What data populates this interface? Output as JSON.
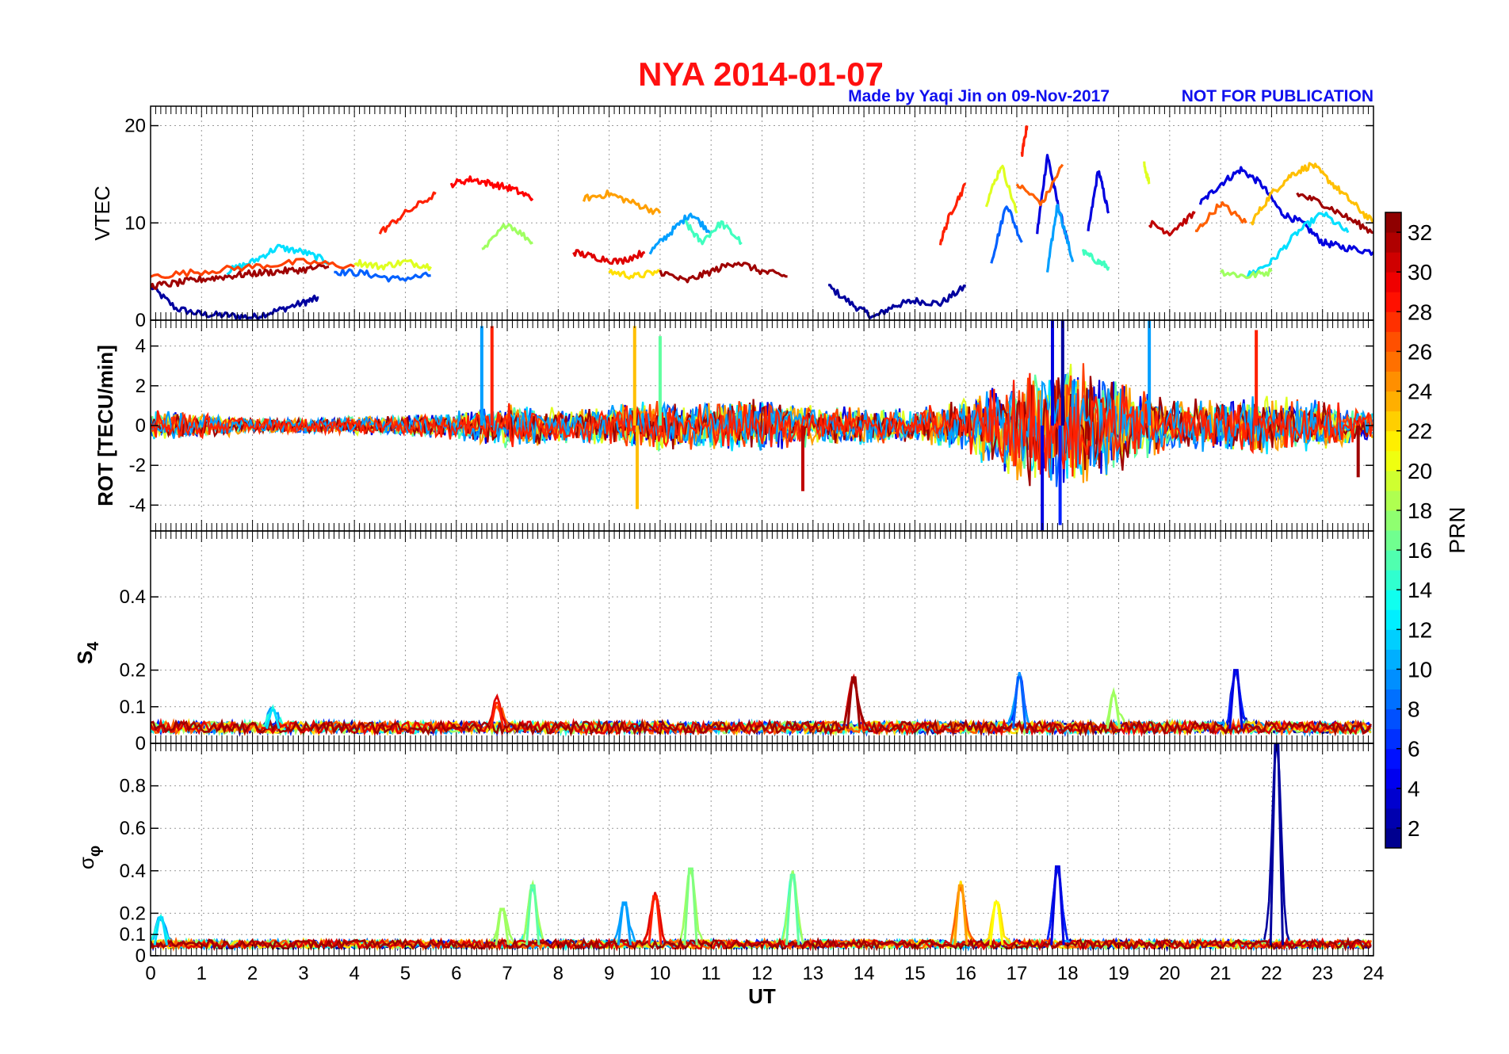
{
  "figure": {
    "title": "NYA   2014-01-07",
    "credit": "Made by Yaqi Jin on 09-Nov-2017",
    "notice": "NOT FOR PUBLICATION",
    "title_color": "#ff1010",
    "credit_color": "#1010ee"
  },
  "chart_data": [
    {
      "type": "line",
      "panel": "vtec",
      "ylabel": "VTEC",
      "xlabel": "",
      "xlim": [
        0,
        24
      ],
      "ylim": [
        0,
        22
      ],
      "yticks": [
        0,
        10,
        20
      ],
      "grid": true,
      "series_color_by": "PRN",
      "series": [
        {
          "prn": 2,
          "x": [
            0,
            0.5,
            1,
            1.5,
            2,
            2.5,
            3,
            3.3
          ],
          "y": [
            3.5,
            1.2,
            0.6,
            0.5,
            0.3,
            1.0,
            1.8,
            2.3
          ]
        },
        {
          "prn": 2,
          "x": [
            13.3,
            13.8,
            14.2,
            14.6,
            15,
            15.5,
            16
          ],
          "y": [
            3.5,
            1.5,
            0.3,
            1.5,
            2.0,
            1.7,
            3.5
          ]
        },
        {
          "prn": 4,
          "x": [
            17.4,
            17.6,
            17.8,
            18
          ],
          "y": [
            9,
            17,
            12,
            8
          ]
        },
        {
          "prn": 4,
          "x": [
            18.4,
            18.6,
            18.8
          ],
          "y": [
            9,
            15.5,
            11
          ]
        },
        {
          "prn": 4,
          "x": [
            20.6,
            21,
            21.4,
            21.8,
            22.2,
            22.6,
            23,
            23.4,
            24
          ],
          "y": [
            12,
            14,
            15.5,
            14,
            11,
            10,
            8,
            7.5,
            7
          ]
        },
        {
          "prn": 8,
          "x": [
            16.5,
            16.8,
            17.1
          ],
          "y": [
            6,
            12,
            8
          ]
        },
        {
          "prn": 8,
          "x": [
            3.6,
            4.2,
            4.8,
            5.5
          ],
          "y": [
            5.0,
            4.8,
            4.2,
            4.6
          ]
        },
        {
          "prn": 10,
          "x": [
            17.6,
            17.8,
            18.1
          ],
          "y": [
            5,
            12,
            6
          ]
        },
        {
          "prn": 10,
          "x": [
            9.8,
            10.2,
            10.6,
            11
          ],
          "y": [
            7,
            9,
            11,
            9
          ]
        },
        {
          "prn": 12,
          "x": [
            1.5,
            2,
            2.5,
            3,
            3.5
          ],
          "y": [
            5,
            6,
            7.5,
            7,
            6
          ]
        },
        {
          "prn": 12,
          "x": [
            21.5,
            22,
            22.5,
            23,
            23.5
          ],
          "y": [
            4.5,
            6,
            9,
            11,
            9
          ]
        },
        {
          "prn": 15,
          "x": [
            10.5,
            10.8,
            11.2,
            11.6
          ],
          "y": [
            10,
            8,
            10,
            8
          ]
        },
        {
          "prn": 15,
          "x": [
            18.3,
            18.6,
            18.8
          ],
          "y": [
            7,
            6,
            5.5
          ]
        },
        {
          "prn": 18,
          "x": [
            6.5,
            7,
            7.5
          ],
          "y": [
            7,
            10,
            8
          ]
        },
        {
          "prn": 18,
          "x": [
            21,
            21.5,
            22
          ],
          "y": [
            5,
            4.5,
            5
          ]
        },
        {
          "prn": 20,
          "x": [
            4,
            4.5,
            5,
            5.5
          ],
          "y": [
            6,
            5.5,
            6,
            5.5
          ]
        },
        {
          "prn": 20,
          "x": [
            16.4,
            16.7,
            17
          ],
          "y": [
            12,
            16,
            11
          ]
        },
        {
          "prn": 20,
          "x": [
            19.5,
            19.6
          ],
          "y": [
            16,
            14
          ]
        },
        {
          "prn": 22,
          "x": [
            9,
            9.5,
            10
          ],
          "y": [
            5,
            4.5,
            5
          ]
        },
        {
          "prn": 23,
          "x": [
            21.6,
            22,
            22.4,
            22.8,
            23.2,
            23.6,
            24
          ],
          "y": [
            10,
            13,
            15,
            16,
            14,
            12,
            10
          ]
        },
        {
          "prn": 24,
          "x": [
            8.5,
            9,
            9.5,
            10
          ],
          "y": [
            12.5,
            13,
            12,
            11
          ]
        },
        {
          "prn": 26,
          "x": [
            17,
            17.5,
            17.9
          ],
          "y": [
            14,
            12,
            16
          ]
        },
        {
          "prn": 26,
          "x": [
            20.5,
            21,
            21.5
          ],
          "y": [
            9,
            12,
            10
          ]
        },
        {
          "prn": 27,
          "x": [
            0,
            1,
            2,
            3,
            4
          ],
          "y": [
            4.5,
            5,
            5.5,
            6,
            5.5
          ]
        },
        {
          "prn": 28,
          "x": [
            4.5,
            5,
            5.6
          ],
          "y": [
            9,
            11,
            13
          ]
        },
        {
          "prn": 28,
          "x": [
            17.1,
            17.2
          ],
          "y": [
            17,
            20
          ]
        },
        {
          "prn": 28,
          "x": [
            15.5,
            15.7,
            16
          ],
          "y": [
            8,
            11,
            14
          ]
        },
        {
          "prn": 29,
          "x": [
            5.9,
            6.3,
            6.7,
            7.1,
            7.5
          ],
          "y": [
            14,
            14.5,
            14,
            13.5,
            12.5
          ]
        },
        {
          "prn": 30,
          "x": [
            8.3,
            8.7,
            9.2,
            9.7
          ],
          "y": [
            7,
            6.5,
            6,
            7
          ]
        },
        {
          "prn": 31,
          "x": [
            19.6,
            20,
            20.5
          ],
          "y": [
            10,
            9,
            11
          ]
        },
        {
          "prn": 32,
          "x": [
            0,
            0.5,
            1,
            1.5,
            2,
            2.5,
            3,
            3.5
          ],
          "y": [
            3.5,
            3.8,
            4.2,
            4.5,
            4.8,
            5,
            5.2,
            5.5
          ]
        },
        {
          "prn": 32,
          "x": [
            10,
            10.5,
            11,
            11.5,
            12,
            12.5
          ],
          "y": [
            5,
            4,
            5,
            6,
            5,
            4.5
          ]
        },
        {
          "prn": 32,
          "x": [
            22.5,
            23,
            23.5,
            24
          ],
          "y": [
            13,
            12,
            10.5,
            9
          ]
        }
      ]
    },
    {
      "type": "line",
      "panel": "rot",
      "ylabel": "ROT [TECU/min]",
      "xlabel": "",
      "xlim": [
        0,
        24
      ],
      "ylim": [
        -5.3,
        5.3
      ],
      "yticks": [
        -4,
        -2,
        0,
        2,
        4
      ],
      "grid": true,
      "envelope": {
        "x": [
          0,
          1,
          2,
          3,
          4,
          5,
          6,
          7,
          8,
          9,
          10,
          11,
          12,
          13,
          14,
          15,
          16,
          17,
          18,
          19,
          20,
          21,
          22,
          23,
          24
        ],
        "amplitude": [
          0.8,
          0.7,
          0.4,
          0.4,
          0.5,
          0.6,
          0.8,
          1.2,
          0.9,
          1.1,
          1.4,
          1.3,
          1.5,
          1.2,
          1.0,
          0.9,
          1.5,
          3.0,
          3.5,
          2.4,
          1.4,
          1.4,
          1.6,
          1.3,
          0.9
        ]
      },
      "spikes": [
        {
          "x": 6.5,
          "y": 5,
          "prn": 10
        },
        {
          "x": 6.7,
          "y": 5,
          "prn": 28
        },
        {
          "x": 9.5,
          "y": 5,
          "prn": 23
        },
        {
          "x": 9.55,
          "y": -4.2,
          "prn": 23
        },
        {
          "x": 10,
          "y": 4.5,
          "prn": 16
        },
        {
          "x": 12.8,
          "y": -3.3,
          "prn": 31
        },
        {
          "x": 17.5,
          "y": -5.3,
          "prn": 4
        },
        {
          "x": 17.7,
          "y": 5.3,
          "prn": 4
        },
        {
          "x": 17.9,
          "y": 5.3,
          "prn": 2
        },
        {
          "x": 17.85,
          "y": -5,
          "prn": 6
        },
        {
          "x": 19.6,
          "y": 5.3,
          "prn": 10
        },
        {
          "x": 21.7,
          "y": 4.8,
          "prn": 28
        },
        {
          "x": 23.7,
          "y": -2.6,
          "prn": 32
        }
      ]
    },
    {
      "type": "line",
      "panel": "s4",
      "ylabel": "S4",
      "xlabel": "",
      "xlim": [
        0,
        24
      ],
      "ylim": [
        0,
        0.58
      ],
      "yticks": [
        0,
        0.1,
        0.2,
        0.4
      ],
      "grid": true,
      "baseline": 0.04,
      "peaks": [
        {
          "x": 13.8,
          "y": 0.18,
          "prn": 32
        },
        {
          "x": 17.05,
          "y": 0.18,
          "prn": 8
        },
        {
          "x": 21.3,
          "y": 0.2,
          "prn": 4
        },
        {
          "x": 6.8,
          "y": 0.11,
          "prn": 28
        },
        {
          "x": 2.4,
          "y": 0.09,
          "prn": 12
        },
        {
          "x": 18.9,
          "y": 0.13,
          "prn": 18
        }
      ]
    },
    {
      "type": "line",
      "panel": "sigma_phi",
      "ylabel": "σφ",
      "xlabel": "UT",
      "xlim": [
        0,
        24
      ],
      "ylim": [
        0,
        1
      ],
      "yticks": [
        0,
        0.1,
        0.2,
        0.4,
        0.6,
        0.8
      ],
      "xticks": [
        0,
        1,
        2,
        3,
        4,
        5,
        6,
        7,
        8,
        9,
        10,
        11,
        12,
        13,
        14,
        15,
        16,
        17,
        18,
        19,
        20,
        21,
        22,
        23,
        24
      ],
      "grid": true,
      "baseline": 0.05,
      "peaks": [
        {
          "x": 22.1,
          "y": 1.0,
          "prn": 2
        },
        {
          "x": 17.8,
          "y": 0.42,
          "prn": 4
        },
        {
          "x": 10.6,
          "y": 0.41,
          "prn": 17
        },
        {
          "x": 12.6,
          "y": 0.38,
          "prn": 16
        },
        {
          "x": 15.9,
          "y": 0.33,
          "prn": 24
        },
        {
          "x": 7.5,
          "y": 0.33,
          "prn": 16
        },
        {
          "x": 9.9,
          "y": 0.28,
          "prn": 28
        },
        {
          "x": 9.3,
          "y": 0.25,
          "prn": 10
        },
        {
          "x": 16.6,
          "y": 0.25,
          "prn": 21
        },
        {
          "x": 6.9,
          "y": 0.22,
          "prn": 18
        },
        {
          "x": 0.2,
          "y": 0.18,
          "prn": 12
        }
      ]
    }
  ],
  "colorbar": {
    "label": "PRN",
    "min": 1,
    "max": 33,
    "ticks": [
      2,
      4,
      6,
      8,
      10,
      12,
      14,
      16,
      18,
      20,
      22,
      24,
      26,
      28,
      30,
      32
    ],
    "colormap": "jet"
  }
}
